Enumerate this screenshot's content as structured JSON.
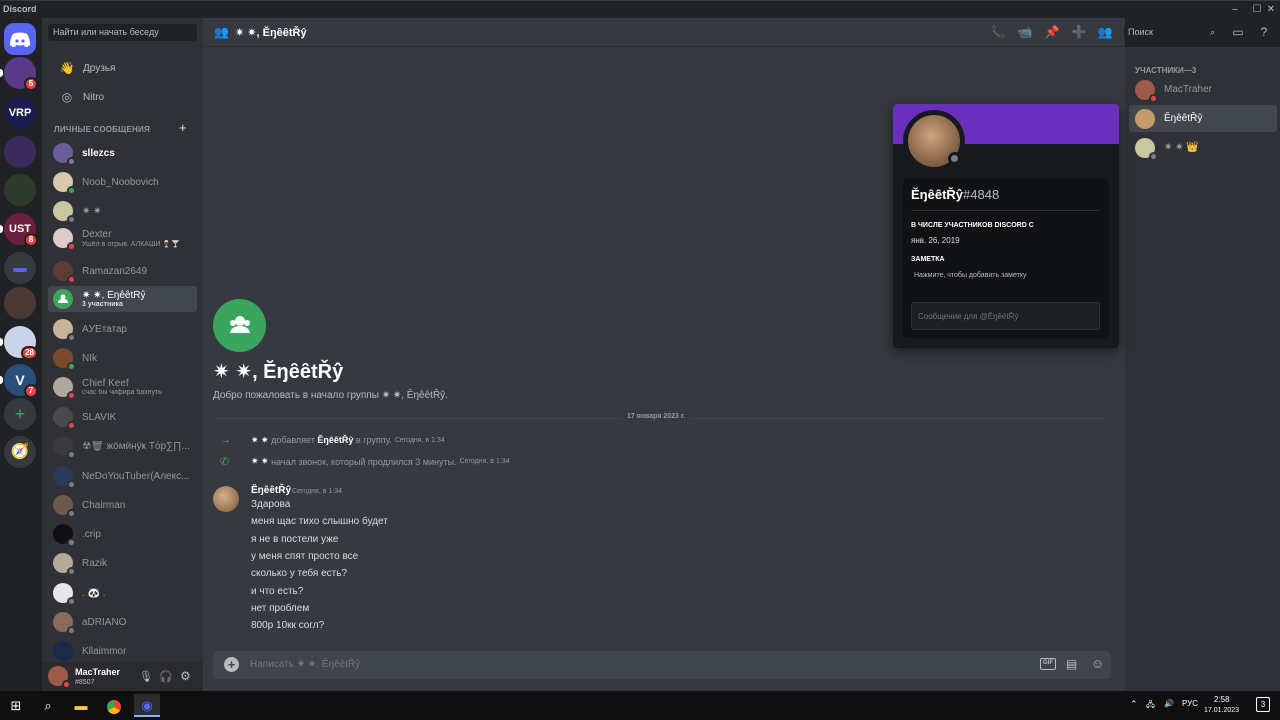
{
  "app": {
    "title": "Discord"
  },
  "servers": [
    {
      "badge": "5",
      "color": "#5a3b8a"
    },
    {
      "badge": "",
      "color": "#1b1d4f",
      "label": "VRP"
    },
    {
      "badge": "",
      "color": "#3b2a5c"
    },
    {
      "badge": "",
      "color": "#2e3b2a"
    },
    {
      "badge": "8",
      "color": "#6b1f3b",
      "label": "UST"
    },
    {
      "badge": "",
      "color": "#36393f"
    },
    {
      "badge": "",
      "color": "#4a3a33"
    },
    {
      "badge": "28",
      "color": "#c9d4e6"
    },
    {
      "badge": "7",
      "color": "#2a4f7a",
      "label": "V"
    }
  ],
  "dm_sidebar": {
    "search_placeholder": "Найти или начать беседу",
    "friends": "Друзья",
    "nitro": "Nitro",
    "header": "ЛИЧНЫЕ СООБЩЕНИЯ",
    "items": [
      {
        "name": "sllezcs",
        "sub": "",
        "status": "off",
        "strong": true,
        "color": "#6b5b9a"
      },
      {
        "name": "Noob_Noobovich",
        "sub": "",
        "status": "on",
        "color": "#d9c7b0"
      },
      {
        "name": "✷ ✷",
        "sub": "",
        "status": "off",
        "color": "#c9c7a0"
      },
      {
        "name": "Dexter",
        "sub": "Ушёл в отрыв. АЛКАШИ 🍷🍸",
        "status": "dnd",
        "color": "#e0c9c9"
      },
      {
        "name": "Ramazan2649",
        "sub": "",
        "status": "dnd",
        "color": "#5a3d33"
      },
      {
        "name": "✷ ✷, ĔŋȇȇtŘŷ",
        "sub": "3 участника",
        "status": "",
        "group": true,
        "selected": true,
        "color": "#3ba55d"
      },
      {
        "name": "AУEтатар",
        "sub": "",
        "status": "off",
        "color": "#c9b29a"
      },
      {
        "name": "NIk",
        "sub": "",
        "status": "on",
        "color": "#7a4a2a"
      },
      {
        "name": "Chief Keef",
        "sub": "счас бы чифира бахнуть",
        "status": "dnd",
        "color": "#b0a8a0"
      },
      {
        "name": "SLAVIK",
        "sub": "",
        "status": "dnd",
        "color": "#4a4a4a"
      },
      {
        "name": "☢🗑 жӧмӥнӱҝ Ťόр∑∏...",
        "sub": "",
        "status": "off",
        "color": "#3a3a3a"
      },
      {
        "name": "NeDoYouTuber(Алекс...",
        "sub": "",
        "status": "off",
        "color": "#2a3a5a"
      },
      {
        "name": "Chairman",
        "sub": "",
        "status": "off",
        "color": "#6a5a4a"
      },
      {
        "name": ".crip",
        "sub": "",
        "status": "off",
        "color": "#101010"
      },
      {
        "name": "Razik",
        "sub": "",
        "status": "off",
        "color": "#b8a898"
      },
      {
        "name": ". 🐼 .",
        "sub": "",
        "status": "off",
        "color": "#e8e8e8"
      },
      {
        "name": "aDRIANO",
        "sub": "",
        "status": "off",
        "color": "#8a6a5a"
      },
      {
        "name": "Kllaimmor",
        "sub": "",
        "status": "",
        "color": "#1a2a4a"
      }
    ]
  },
  "user_panel": {
    "name": "MacTraher",
    "tag": "#8507"
  },
  "chat": {
    "title": "✷ ✷, ĔŋȇȇtŘŷ",
    "search": "Поиск",
    "group_title": "✷ ✷, ĔŋȇȇtŘŷ",
    "welcome": "Добро пожаловать в начало группы ✷ ✷, ĔŋȇȇtŘŷ.",
    "date_divider": "17 января 2023 г.",
    "system": [
      {
        "actor": "✷ ✷",
        "text": "добавляет",
        "target": "ĔŋȇȇtŘŷ",
        "tail": "в группу.",
        "time": "Сегодня, в 1:34"
      },
      {
        "actor": "✷ ✷",
        "text": "начал звонок, который продлился 3 минуты.",
        "target": "",
        "tail": "",
        "time": "Сегодня, в 1:34"
      }
    ],
    "message": {
      "author": "ĔŋȇȇtŘŷ",
      "time": "Сегодня, в 1:34",
      "lines": [
        "Здарова",
        "меня щас тихо слышно будет",
        "я не в постели уже",
        "у меня спят просто все",
        "сколько у тебя есть?",
        "и что есть?",
        "нет проблем",
        "800р 10кк согл?"
      ]
    },
    "composer_placeholder": "Написать ✷ ✷, ĔŋȇȇtŘŷ"
  },
  "popout": {
    "name": "ĔŋȇȇtŘŷ",
    "discriminator": "#4848",
    "member_since_label": "В ЧИСЛЕ УЧАСТНИКОВ DISCORD С",
    "member_since": "янв. 26, 2019",
    "note_label": "ЗАМЕТКА",
    "note_placeholder": "Нажмите, чтобы добавить заметку",
    "message_placeholder": "Сообщение для @ĔŋȇȇtŘŷ",
    "banner_color": "#6b2fbd"
  },
  "members": {
    "header": "УЧАСТНИКИ—3",
    "items": [
      {
        "name": "MacTraher",
        "status": "dnd",
        "color": "#a05a4a"
      },
      {
        "name": "ĔŋȇȇtŘŷ",
        "status": "",
        "selected": true,
        "color": "#c49a6c"
      },
      {
        "name": "✷ ✷ 👑",
        "status": "off",
        "color": "#c9c7a0"
      }
    ]
  },
  "taskbar": {
    "lang": "РУС",
    "time": "2:58",
    "date": "17.01.2023",
    "notif": "3"
  }
}
